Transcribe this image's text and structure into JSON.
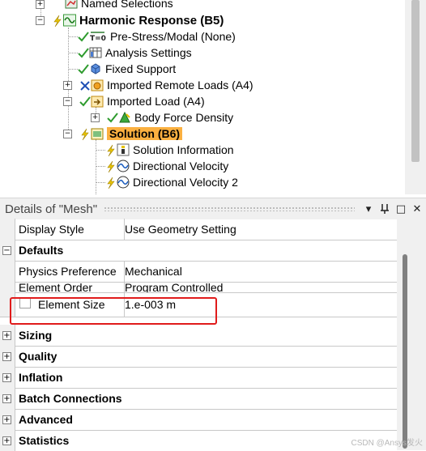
{
  "tree": {
    "items": [
      {
        "label": "Named Selections"
      },
      {
        "label": "Harmonic Response (B5)"
      },
      {
        "label": "Pre-Stress/Modal (None)"
      },
      {
        "label": "Analysis Settings"
      },
      {
        "label": "Fixed Support"
      },
      {
        "label": "Imported Remote Loads (A4)"
      },
      {
        "label": "Imported Load (A4)"
      },
      {
        "label": "Body Force Density"
      },
      {
        "label": "Solution (B6)"
      },
      {
        "label": "Solution Information"
      },
      {
        "label": "Directional Velocity"
      },
      {
        "label": "Directional Velocity 2"
      }
    ],
    "icon_glyph_t0": "T=0"
  },
  "details": {
    "title": "Details of \"Mesh\"",
    "buttons": {
      "dropdown": "▾",
      "pin": "Ⅱ",
      "maximize": "□",
      "close": "✕"
    },
    "rows": [
      {
        "label": "Display Style",
        "value": "Use Geometry Setting"
      },
      {
        "category": "Defaults"
      },
      {
        "label": "Physics Preference",
        "value": "Mechanical"
      },
      {
        "label": "Element Order",
        "value": "Program Controlled"
      },
      {
        "label": "Element Size",
        "value": "1.e-003 m"
      },
      {
        "category": "Sizing"
      },
      {
        "category": "Quality"
      },
      {
        "category": "Inflation"
      },
      {
        "category": "Batch Connections"
      },
      {
        "category": "Advanced"
      },
      {
        "category": "Statistics"
      }
    ]
  },
  "expander": {
    "plus": "+",
    "minus": "−"
  },
  "watermark": "CSDN @Ansys发火",
  "colors": {
    "highlight": "#fbb040",
    "redbox": "#e01b1b",
    "check_green": "#2e9b2e",
    "lightning": "#e8c400"
  }
}
